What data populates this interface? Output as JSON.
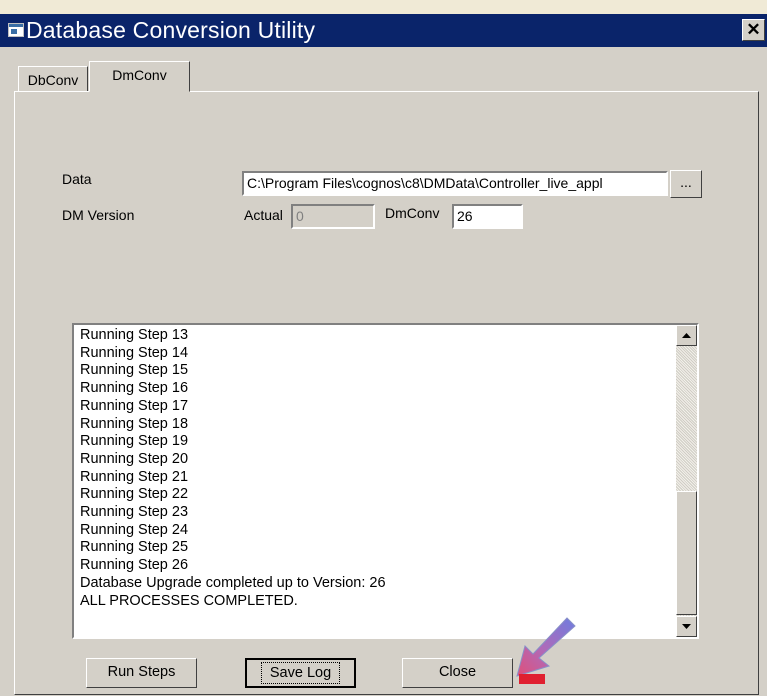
{
  "window": {
    "title": "Database Conversion Utility",
    "close_glyph": "✕",
    "icon": "app-window-icon"
  },
  "tabs": [
    {
      "label": "DbConv",
      "active": false
    },
    {
      "label": "DmConv",
      "active": true
    }
  ],
  "form": {
    "data_label": "Data",
    "data_path": "C:\\Program Files\\cognos\\c8\\DMData\\Controller_live_appl",
    "browse_label": "...",
    "dm_version_label": "DM Version",
    "actual_label": "Actual",
    "actual_value": "0",
    "dmconv_label": "DmConv",
    "dmconv_value": "26"
  },
  "log": {
    "lines": [
      "Running Step 13",
      "Running Step 14",
      "Running Step 15",
      "Running Step 16",
      "Running Step 17",
      "Running Step 18",
      "Running Step 19",
      "Running Step 20",
      "Running Step 21",
      "Running Step 22",
      "Running Step 23",
      "Running Step 24",
      "Running Step 25",
      "Running Step 26",
      "Database Upgrade completed up to Version: 26",
      "ALL PROCESSES COMPLETED."
    ]
  },
  "buttons": {
    "run_steps": "Run Steps",
    "save_log": "Save Log",
    "close": "Close"
  },
  "colors": {
    "titlebar": "#0a246a",
    "dialog": "#d4d0c8",
    "arrow_pink": "#e0507a",
    "arrow_blue": "#7878d8",
    "arrow_red": "#e02030"
  }
}
